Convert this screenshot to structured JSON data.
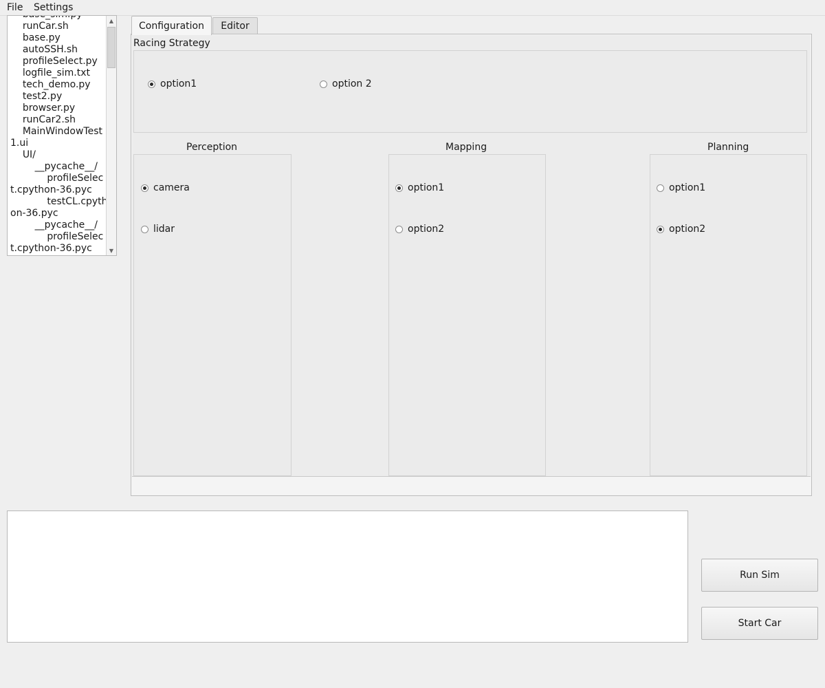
{
  "menu": {
    "file": "File",
    "settings": "Settings"
  },
  "file_tree": {
    "items": [
      "    base_sim.py",
      "    runCar.sh",
      "    base.py",
      "    autoSSH.sh",
      "    profileSelect.py",
      "    logfile_sim.txt",
      "    tech_demo.py",
      "    test2.py",
      "    browser.py",
      "    runCar2.sh",
      "    MainWindowTest1.ui",
      "    UI/",
      "        __pycache__/",
      "            profileSelect.cpython-36.pyc",
      "            testCL.cpython-36.pyc",
      "        __pycache__/",
      "            profileSelect.cpython-36.pyc"
    ]
  },
  "tabs": {
    "configuration": "Configuration",
    "editor": "Editor"
  },
  "racing_strategy": {
    "title": "Racing Strategy",
    "options": [
      {
        "label": "option1",
        "checked": true
      },
      {
        "label": "option 2",
        "checked": false
      }
    ]
  },
  "perception": {
    "title": "Perception",
    "options": [
      {
        "label": "camera",
        "checked": true
      },
      {
        "label": "lidar",
        "checked": false
      }
    ]
  },
  "mapping": {
    "title": "Mapping",
    "options": [
      {
        "label": "option1",
        "checked": true
      },
      {
        "label": "option2",
        "checked": false
      }
    ]
  },
  "planning": {
    "title": "Planning",
    "options": [
      {
        "label": "option1",
        "checked": false
      },
      {
        "label": "option2",
        "checked": true
      }
    ]
  },
  "buttons": {
    "run_sim": "Run Sim",
    "start_car": "Start Car"
  }
}
